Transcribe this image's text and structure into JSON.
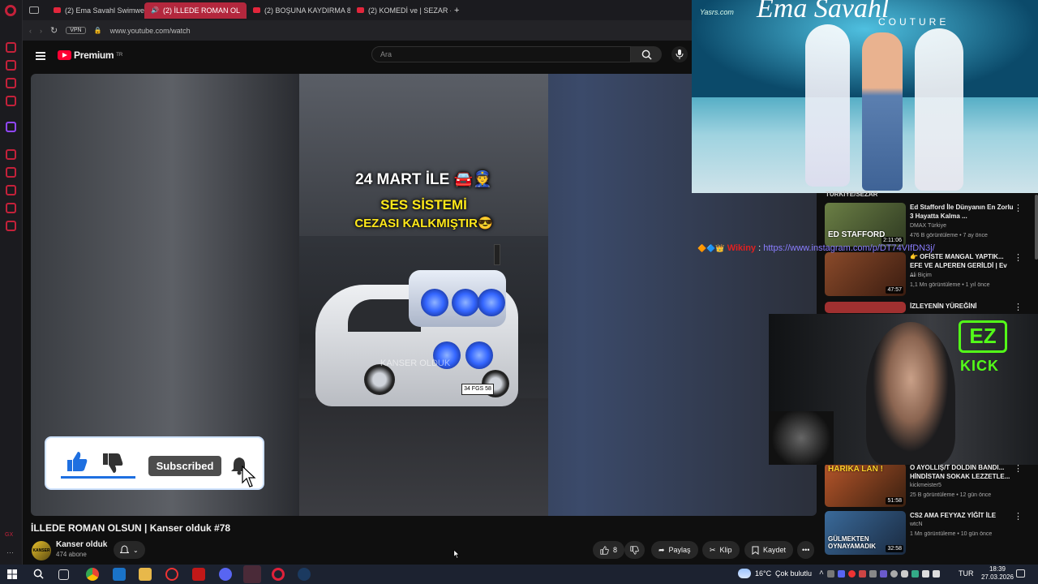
{
  "browser": {
    "tabs": [
      {
        "label": "(2) Ema Savahl Swimwear",
        "active": false
      },
      {
        "label": "(2) İLLEDE ROMAN OL",
        "active": true
      },
      {
        "label": "(2) BOŞUNA KAYDIRMA 8",
        "active": false
      },
      {
        "label": "(2) KOMEDİ ve | SEZAR - Y",
        "active": false
      }
    ],
    "new_tab": "+",
    "vpn_badge": "VPN",
    "url": "www.youtube.com/watch"
  },
  "youtube": {
    "logo": "Premium",
    "logo_sup": "TR",
    "search_placeholder": "Ara"
  },
  "video": {
    "caption_line1": "24 MART İLE 🚘👮",
    "caption_line2": "SES SİSTEMİ",
    "caption_line3": "CEZASI KALKMIŞTIR😎",
    "watermark": "KANSER OLDUK",
    "plate": "34 FGS 58",
    "subscribe_overlay_label": "Subscribed"
  },
  "meta": {
    "title": "İLLEDE ROMAN OLSUN | Kanser olduk #78",
    "channel_avatar_text": "KANSER OLDUK",
    "channel": "Kanser olduk",
    "subscribers": "474 abone",
    "likes": "8",
    "share": "Paylaş",
    "clip": "Klip",
    "save": "Kaydet"
  },
  "suggestions": {
    "header": "TÜRKİYE/SEZAR",
    "items": [
      {
        "title": "Ed Stafford İle Dünyanın En Zorlu 3 Hayatta Kalma ...",
        "channel": "DMAX Türkiye",
        "stats": "476 B görüntüleme • 7 ay önce",
        "duration": "2:11:06",
        "thumb_text": "ED STAFFORD",
        "thumb_color": "#6b7f45"
      },
      {
        "title": "👉 OFİSTE MANGAL YAPTIK... EFE VE ALPEREN GERİLDİ | Ev ...",
        "channel": "Ali Biçim",
        "stats": "1,1 Mn görüntüleme • 1 yıl önce",
        "duration": "47:57",
        "thumb_text": "",
        "thumb_color": "#8a4a2a"
      },
      {
        "title": "İZLEYENİN YÜREĞİNİ",
        "channel": "",
        "stats": "",
        "duration": "",
        "thumb_text": "",
        "thumb_color": "#a03030"
      },
      {
        "title": "O AYOLLIŞ/T DOLDIN BANDI... HİNDİSTAN SOKAK LEZZETLE...",
        "channel": "kickmeister5",
        "stats": "25 B görüntüleme • 12 gün önce",
        "duration": "51:58",
        "thumb_text": "HARİKA LAN !",
        "thumb_color": "#b5552a"
      },
      {
        "title": "CS2 AMA FEYYAZ YİĞİT İLE",
        "channel": "wtcN",
        "stats": "1 Mn görüntüleme • 10 gün önce",
        "duration": "32:58",
        "thumb_text": "GÜLMEKTEN OYNAYAMADIK",
        "thumb_color": "#3a6a9a"
      }
    ]
  },
  "overlays": {
    "runway_watermark": "Yasrs.com",
    "runway_logo": "Ema Savahl",
    "runway_logo_sub": "COUTURE",
    "chat_user": "Wikiny",
    "chat_sep": ":",
    "chat_link": "https://www.instagram.com/p/DT74VIfDN3j/",
    "cam_brand_top": "EZ",
    "cam_brand": "KICK"
  },
  "taskbar": {
    "weather_temp": "16°C",
    "weather_text": "Çok bulutlu",
    "lang": "TUR",
    "time": "18:39",
    "date": "27.03.2026"
  },
  "colors": {
    "opera_red": "#c4213a",
    "yt_red": "#ff0033",
    "kick_green": "#53fc18",
    "chat_link": "#8a7dff"
  },
  "icons": [
    "opera-icon",
    "search-icon",
    "mic-icon",
    "like-icon",
    "dislike-icon",
    "bell-icon",
    "share-icon",
    "scissors-icon",
    "bookmark-icon",
    "more-icon",
    "windows-icon",
    "chevron-down-icon"
  ]
}
